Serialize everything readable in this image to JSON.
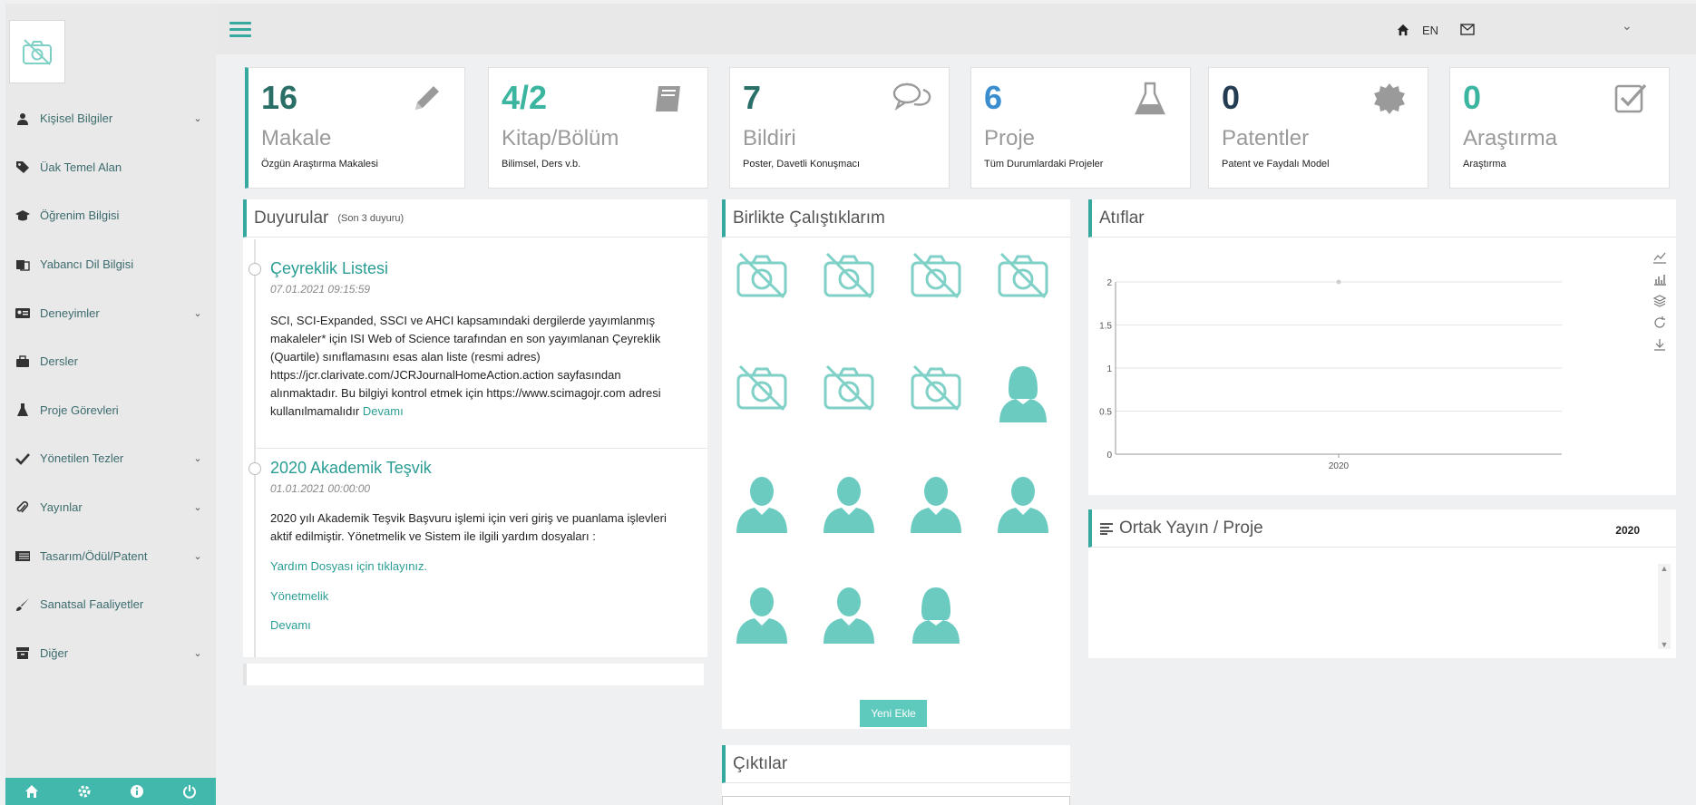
{
  "sidebar": {
    "items": [
      {
        "label": "Kişisel Bilgiler",
        "icon": "user-icon",
        "chevron": true
      },
      {
        "label": "Üak Temel Alan",
        "icon": "tag-icon",
        "chevron": false
      },
      {
        "label": "Öğrenim Bilgisi",
        "icon": "graduation-cap-icon",
        "chevron": false
      },
      {
        "label": "Yabancı Dil Bilgisi",
        "icon": "language-icon",
        "chevron": false
      },
      {
        "label": "Deneyimler",
        "icon": "id-card-icon",
        "chevron": true
      },
      {
        "label": "Dersler",
        "icon": "briefcase-icon",
        "chevron": false
      },
      {
        "label": "Proje Görevleri",
        "icon": "flask-icon",
        "chevron": false
      },
      {
        "label": "Yönetilen Tezler",
        "icon": "check-icon",
        "chevron": true
      },
      {
        "label": "Yayınlar",
        "icon": "paperclip-icon",
        "chevron": true
      },
      {
        "label": "Tasarım/Ödül/Patent",
        "icon": "list-icon",
        "chevron": true
      },
      {
        "label": "Sanatsal Faaliyetler",
        "icon": "brush-icon",
        "chevron": false
      },
      {
        "label": "Diğer",
        "icon": "archive-icon",
        "chevron": true
      }
    ],
    "chevron_glyph": "⌄"
  },
  "topbar": {
    "lang": "EN",
    "dropdown": "⌄"
  },
  "cards": [
    {
      "num": "16",
      "title": "Makale",
      "sub": "Özgün Araştırma Makalesi",
      "color": "#2a6f67",
      "icon": "pencil-icon"
    },
    {
      "num": "4/2",
      "title": "Kitap/Bölüm",
      "sub": "Bilimsel, Ders v.b.",
      "color": "#3bb5a0",
      "icon": "book-icon"
    },
    {
      "num": "7",
      "title": "Bildiri",
      "sub": "Poster, Davetli Konuşmacı",
      "color": "#2a6f67",
      "icon": "comments-icon"
    },
    {
      "num": "6",
      "title": "Proje",
      "sub": "Tüm Durumlardaki Projeler",
      "color": "#3a8ecf",
      "icon": "flask-icon"
    },
    {
      "num": "0",
      "title": "Patentler",
      "sub": "Patent ve Faydalı Model",
      "color": "#243c52",
      "icon": "certificate-icon"
    },
    {
      "num": "0",
      "title": "Araştırma",
      "sub": "Araştırma",
      "color": "#3bb5a0",
      "icon": "checkbox-icon"
    }
  ],
  "announcements": {
    "title": "Duyurular",
    "subtitle": "(Son 3 duyuru)",
    "items": [
      {
        "title": "Çeyreklik Listesi",
        "date": "07.01.2021 09:15:59",
        "body": "SCI, SCI-Expanded, SSCI ve AHCI kapsamındaki dergilerde yayımlanmış makaleler* için ISI Web of Science tarafından en son yayımlanan Çeyreklik (Quartile) sınıflamasını esas alan liste (resmi adres) https://jcr.clarivate.com/JCRJournalHomeAction.action sayfasından alınmaktadır. Bu bilgiyi kontrol etmek için https://www.scimagojr.com adresi kullanılmamalıdır",
        "more": "Devamı"
      },
      {
        "title": "2020 Akademik Teşvik",
        "date": "01.01.2021 00:00:00",
        "body": "2020 yılı Akademik Teşvik Başvuru işlemi için veri giriş ve puanlama işlevleri aktif edilmiştir. Yönetmelik ve Sistem ile ilgili yardım dosyaları :",
        "links": [
          "Yardım Dosyası için tıklayınız.",
          "Yönetmelik",
          "Devamı"
        ]
      }
    ]
  },
  "collaborators": {
    "title": "Birlikte Çalıştıklarım",
    "photos": [
      "no-photo",
      "no-photo",
      "no-photo",
      "no-photo",
      "no-photo",
      "no-photo",
      "no-photo",
      "female",
      "male",
      "male",
      "male",
      "male",
      "male",
      "male",
      "female"
    ],
    "add_label": "Yeni Ekle"
  },
  "outputs": {
    "title": "Çıktılar"
  },
  "citations": {
    "title": "Atıflar"
  },
  "joint": {
    "title": "Ortak Yayın / Proje",
    "year": "2020"
  },
  "chart_data": {
    "type": "line",
    "title": "",
    "x": [
      "2020"
    ],
    "series": [
      {
        "values": [
          2
        ]
      }
    ],
    "ylim": [
      0,
      2
    ],
    "yticks": [
      "0",
      "0.5",
      "1",
      "1.5",
      "2"
    ],
    "xlabel": "",
    "ylabel": "",
    "grid": true,
    "colors": {
      "grid": "#e3e3e3",
      "point": "#cfcfcf"
    }
  }
}
